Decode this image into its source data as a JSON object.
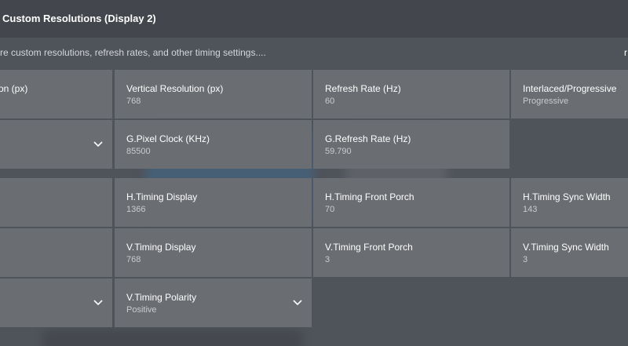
{
  "dialog": {
    "title": "Custom Resolutions (Display 2)",
    "subtitle": "re custom resolutions, refresh rates, and other timing settings....",
    "corner_link": "r"
  },
  "grid": {
    "row1": {
      "col0": {
        "label": "on (px)"
      },
      "col1": {
        "label": "Vertical Resolution (px)",
        "value": "768"
      },
      "col2": {
        "label": "Refresh Rate (Hz)",
        "value": "60"
      },
      "col3": {
        "label": "Interlaced/Progressive",
        "value": "Progressive"
      }
    },
    "row2": {
      "col1": {
        "label": "G.Pixel Clock (KHz)",
        "value": "85500"
      },
      "col2": {
        "label": "G.Refresh Rate (Hz)",
        "value": "59.790"
      }
    },
    "row3": {
      "col1": {
        "label": "H.Timing Display",
        "value": "1366"
      },
      "col2": {
        "label": "H.Timing Front Porch",
        "value": "70"
      },
      "col3": {
        "label": "H.Timing Sync Width",
        "value": "143"
      }
    },
    "row4": {
      "col1": {
        "label": "V.Timing Display",
        "value": "768"
      },
      "col2": {
        "label": "V.Timing Front Porch",
        "value": "3"
      },
      "col3": {
        "label": "V.Timing Sync Width",
        "value": "3"
      }
    },
    "row5": {
      "col1": {
        "label": "V.Timing Polarity",
        "value": "Positive"
      }
    }
  },
  "icons": {
    "dropdown": "chevron-down-icon"
  }
}
